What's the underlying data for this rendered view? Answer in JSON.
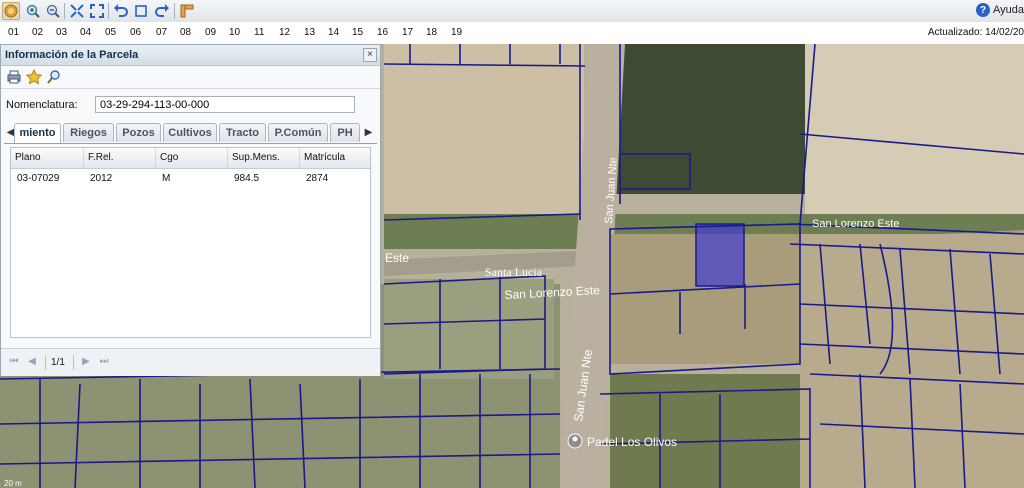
{
  "toolbar": {
    "buttons": [
      "globe-icon",
      "zoom-in-icon",
      "zoom-out-icon",
      "full-extent-icon",
      "expand-icon",
      "undo-icon",
      "select-box-icon",
      "redo-icon",
      "measure-icon"
    ],
    "help_label": "Ayuda"
  },
  "levels": {
    "items": [
      "01",
      "02",
      "03",
      "04",
      "05",
      "06",
      "07",
      "08",
      "09",
      "10",
      "11",
      "12",
      "13",
      "14",
      "15",
      "16",
      "17",
      "18",
      "19"
    ],
    "updated": "Actualizado: 14/02/20"
  },
  "map": {
    "labels": {
      "san_juan_nte_top": "San Juan Nte",
      "san_juan_nte_bottom": "San Juan Nte",
      "san_lorenzo_este": "San Lorenzo Este",
      "san_lorenzo_este_right": "San Lorenzo Este",
      "este": "Este",
      "santa_lucia": "Santa Lucia",
      "padel": "Padel Los Olivos",
      "scale": "20 m"
    },
    "colors": {
      "parcel_line": "#1a1a8c",
      "highlight": "#3a35d8"
    }
  },
  "panel": {
    "title": "Información de la Parcela",
    "close": "×",
    "tools": [
      "printer-icon",
      "star-icon",
      "search-icon"
    ],
    "nomenclatura_label": "Nomenclatura:",
    "nomenclatura_value": "03-29-294-113-00-000",
    "tabs": [
      "miento",
      "Riegos",
      "Pozos",
      "Cultivos",
      "Tracto",
      "P.Común",
      "PH"
    ],
    "grid": {
      "columns": [
        "Plano",
        "F.Rel.",
        "Cgo",
        "Sup.Mens.",
        "Matrícula"
      ],
      "rows": [
        [
          "03-07029",
          "2012",
          "M",
          "984.5",
          "2874"
        ]
      ]
    },
    "pager": {
      "info": "1/1"
    }
  }
}
